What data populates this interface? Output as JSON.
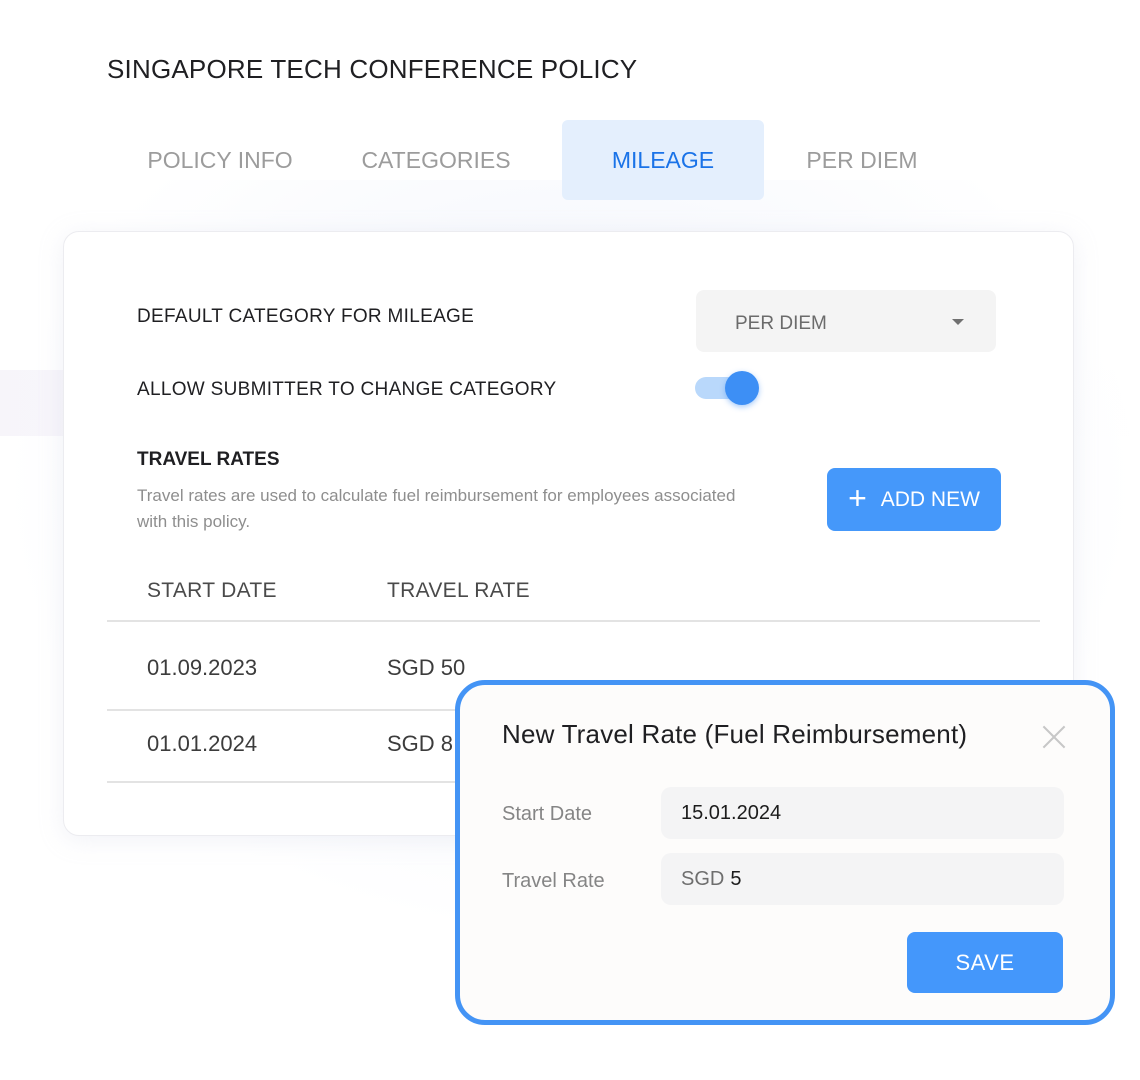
{
  "page": {
    "title": "SINGAPORE TECH CONFERENCE POLICY"
  },
  "tabs": [
    {
      "label": "POLICY INFO",
      "active": false
    },
    {
      "label": "CATEGORIES",
      "active": false
    },
    {
      "label": "MILEAGE",
      "active": true
    },
    {
      "label": "PER DIEM",
      "active": false
    }
  ],
  "mileage": {
    "default_category_label": "DEFAULT CATEGORY FOR MILEAGE",
    "default_category_value": "PER DIEM",
    "allow_change_label": "ALLOW SUBMITTER TO CHANGE CATEGORY",
    "allow_change_enabled": true
  },
  "travel_rates": {
    "title": "TRAVEL RATES",
    "description": "Travel rates are used to calculate fuel reimbursement for employees associated with this policy.",
    "add_button_icon": "plus-icon",
    "add_button_label": "ADD NEW",
    "columns": [
      "START DATE",
      "TRAVEL RATE"
    ],
    "rows": [
      {
        "start_date": "01.09.2023",
        "travel_rate": "SGD 50"
      },
      {
        "start_date": "01.01.2024",
        "travel_rate": "SGD 8"
      }
    ]
  },
  "modal": {
    "title": "New Travel Rate (Fuel Reimbursement)",
    "close_icon": "close-icon",
    "start_date_label": "Start Date",
    "start_date_value": "15.01.2024",
    "travel_rate_label": "Travel Rate",
    "travel_rate_prefix": "SGD",
    "travel_rate_value": "5",
    "save_label": "SAVE"
  },
  "colors": {
    "accent": "#4598fa",
    "active_tab_bg": "#e4effd",
    "active_tab_text": "#1a73e8",
    "toggle_track": "#b9d8fb",
    "modal_border": "#4494f5"
  }
}
